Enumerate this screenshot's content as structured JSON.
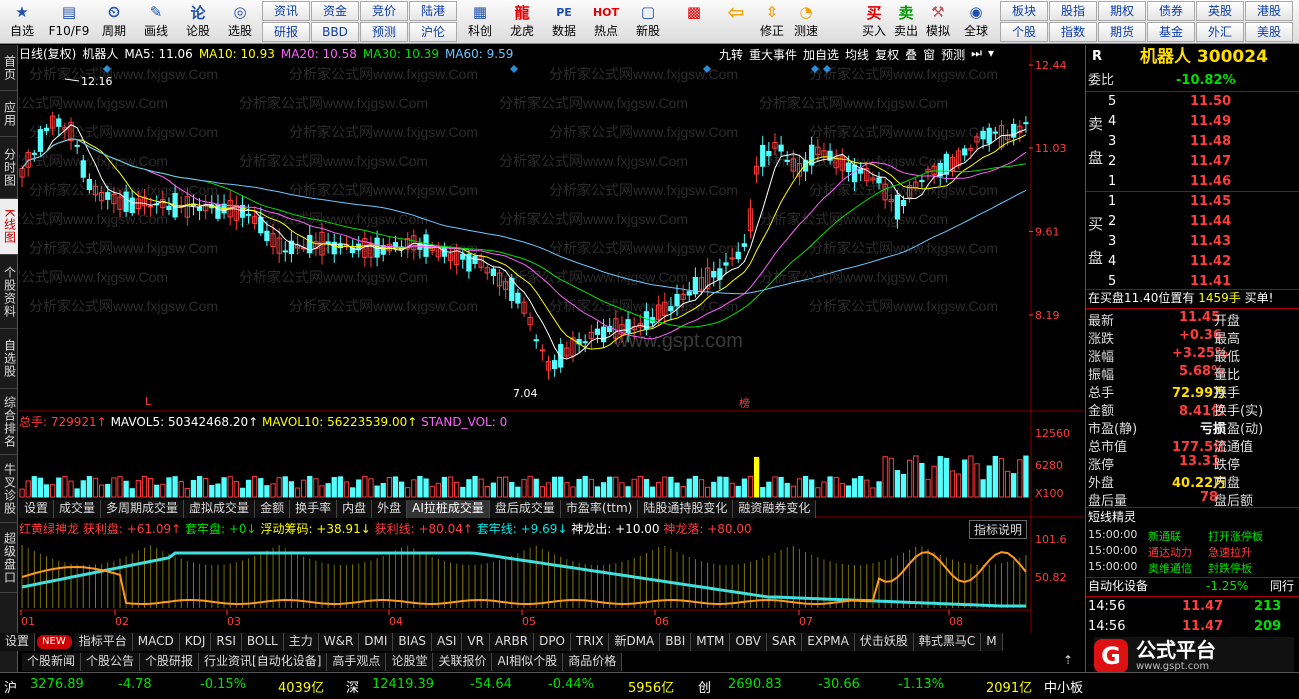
{
  "toolbar": {
    "buttons": [
      {
        "label": "自选",
        "icon": "star-icon"
      },
      {
        "label": "F10/F9",
        "icon": "f10-icon"
      },
      {
        "label": "周期",
        "icon": "period-icon"
      },
      {
        "label": "画线",
        "icon": "pen-icon"
      },
      {
        "label": "论股",
        "icon": "forum-icon"
      },
      {
        "label": "选股",
        "icon": "select-icon"
      }
    ],
    "grid_a": [
      "资讯",
      "资金",
      "竞价",
      "陆港",
      "研报",
      "BBD",
      "预测",
      "沪伦"
    ],
    "buttons2": [
      {
        "label": "科创",
        "icon": "chart-icon"
      },
      {
        "label": "龙虎",
        "icon": "dragon-icon"
      },
      {
        "label": "数据",
        "icon": "pe-icon"
      },
      {
        "label": "热点",
        "icon": "hot-icon"
      },
      {
        "label": "新股",
        "icon": "newstock-icon"
      }
    ],
    "buttons3": [
      {
        "label": "",
        "icon": "layout-icon"
      },
      {
        "label": "",
        "icon": "back-arrow-icon"
      },
      {
        "label": "修正",
        "icon": "up-arrow-icon"
      },
      {
        "label": "测速",
        "icon": "speed-icon"
      },
      {
        "label": "买入",
        "icon": "buy-icon"
      },
      {
        "label": "卖出",
        "icon": "sell-icon"
      },
      {
        "label": "模拟",
        "icon": "hammer-icon"
      },
      {
        "label": "全球",
        "icon": "globe-icon"
      }
    ],
    "grid_b": [
      "板块",
      "股指",
      "期权",
      "债券",
      "英股",
      "港股",
      "个股",
      "指数",
      "期货",
      "基金",
      "外汇",
      "美股"
    ]
  },
  "left_tabs": [
    "首页",
    "应用",
    "分时图",
    "K线图",
    "个股资料",
    "自选股",
    "综合排名",
    "牛叉诊股",
    "超级盘口"
  ],
  "kline": {
    "header_name": "日线(复权)",
    "stock": "机器人",
    "ma5": "MA5: 11.06",
    "ma10": "MA10: 10.93",
    "ma20": "MA20: 10.58",
    "ma30": "MA30: 10.39",
    "ma60": "MA60: 9.59",
    "right_buttons": [
      "九转",
      "重大事件",
      "加自选",
      "均线",
      "复权",
      "叠",
      "窗",
      "预测"
    ],
    "high_label": "12.16",
    "low_label": "7.04",
    "marker_l": "L",
    "marker_bang": "榜",
    "price_ticks": [
      "12.44",
      "11.03",
      "9.61",
      "8.19"
    ],
    "watermark": "分析家公式网www.fxjgsw.Com",
    "center_wm": "www.gspt.com"
  },
  "volume": {
    "label_total": "总手: 729921↑",
    "mavol5": "MAVOL5: 50342468.20↑",
    "mavol10": "MAVOL10: 56223539.00↑",
    "stand": "STAND_VOL: 0",
    "ticks": [
      "12560",
      "6280",
      "X100"
    ]
  },
  "sub_tabs": [
    "设置",
    "成交量",
    "多周期成交量",
    "虚拟成交量",
    "金额",
    "换手率",
    "内盘",
    "外盘",
    "AI拉桩成交量",
    "盘后成交量",
    "市盈率(ttm)",
    "陆股通持股变化",
    "融资融券变化"
  ],
  "indicator": {
    "name": "红黄绿神龙",
    "v1": "获利盘: +61.09↑",
    "v2": "套牢盘: +0↓",
    "v3": "浮动筹码: +38.91↓",
    "v4": "获利线: +80.04↑",
    "v5": "套牢线: +9.69↓",
    "v6": "神龙出: +10.00",
    "v7": "神龙落: +80.00",
    "explain": "指标说明",
    "ticks": [
      "101.6",
      "50.82"
    ]
  },
  "months": [
    "01",
    "02",
    "03",
    "04",
    "05",
    "06",
    "07",
    "08"
  ],
  "bottom_tabs": [
    "设置",
    "NEW",
    "指标平台",
    "MACD",
    "KDJ",
    "RSI",
    "BOLL",
    "主力",
    "W&R",
    "DMI",
    "BIAS",
    "ASI",
    "VR",
    "ARBR",
    "DPO",
    "TRIX",
    "新DMA",
    "BBI",
    "MTM",
    "OBV",
    "SAR",
    "EXPMA",
    "伏击妖股",
    "韩式黑马C",
    "M"
  ],
  "news_tabs": [
    "个股新闻",
    "个股公告",
    "个股研报",
    "行业资讯[自动化设备]",
    "高手观点",
    "论股堂",
    "关联报价",
    "AI相似个股",
    "商品价格"
  ],
  "right_panel": {
    "code_label": "R",
    "name": "机器人",
    "code": "300024",
    "weibi_label": "委比",
    "weibi": "-10.82%",
    "sell_label": [
      "卖",
      "盘"
    ],
    "buy_label": [
      "买",
      "盘"
    ],
    "sell": [
      [
        "5",
        "11.50"
      ],
      [
        "4",
        "11.49"
      ],
      [
        "3",
        "11.48"
      ],
      [
        "2",
        "11.47"
      ],
      [
        "1",
        "11.46"
      ]
    ],
    "buy": [
      [
        "1",
        "11.45"
      ],
      [
        "2",
        "11.44"
      ],
      [
        "3",
        "11.43"
      ],
      [
        "4",
        "11.42"
      ],
      [
        "5",
        "11.41"
      ]
    ],
    "notice_a": "在买盘11.40位置有",
    "notice_b": "1459手",
    "notice_c": "买单!",
    "stats": [
      [
        "最新",
        "11.45",
        "开盘"
      ],
      [
        "涨跌",
        "+0.36",
        "最高"
      ],
      [
        "涨幅",
        "+3.25%",
        "最低"
      ],
      [
        "振幅",
        "5.68%",
        "量比"
      ],
      [
        "总手",
        "72.99万",
        "换手"
      ],
      [
        "金额",
        "8.41亿",
        "换手(实)"
      ],
      [
        "市盈(静)",
        "亏损",
        "市盈(动)"
      ],
      [
        "总市值",
        "177.5亿",
        "流通值"
      ],
      [
        "涨停",
        "13.31",
        "跌停"
      ],
      [
        "外盘",
        "40.22万",
        "内盘"
      ],
      [
        "盘后量",
        "78",
        "盘后额"
      ]
    ],
    "short_title": "短线精灵",
    "short": [
      [
        "15:00:00",
        "新通联",
        "打开涨停板"
      ],
      [
        "15:00:00",
        "通达动力",
        "急速拉升"
      ],
      [
        "15:00:00",
        "奥维通信",
        "封跌停板"
      ]
    ],
    "sector_name": "自动化设备",
    "sector_pct": "-1.25%",
    "sector_next": "同行",
    "ticks": [
      [
        "14:56",
        "11.47",
        "213"
      ],
      [
        "14:56",
        "11.47",
        "209"
      ]
    ]
  },
  "status": {
    "sh_label": "沪",
    "sh_val": "3276.89",
    "sh_chg": "-4.78",
    "sh_pct": "-0.15%",
    "sh_amt": "4039亿",
    "sz_label": "深",
    "sz_val": "12419.39",
    "sz_chg": "-54.64",
    "sz_pct": "-0.44%",
    "sz_amt": "5956亿",
    "cy_label": "创",
    "cy_val": "2690.83",
    "cy_chg": "-30.66",
    "cy_pct": "-1.13%",
    "cy_amt": "2091亿",
    "tail": "中小板"
  },
  "logo": {
    "text": "公式平台",
    "url": "www.gspt.com"
  },
  "colors": {
    "up": "#ff3c3c",
    "down": "#54ffff",
    "ma5": "#ffffff",
    "ma10": "#ffff00",
    "ma20": "#ff60ff",
    "ma30": "#00e000",
    "ma60": "#6ec6ff"
  }
}
